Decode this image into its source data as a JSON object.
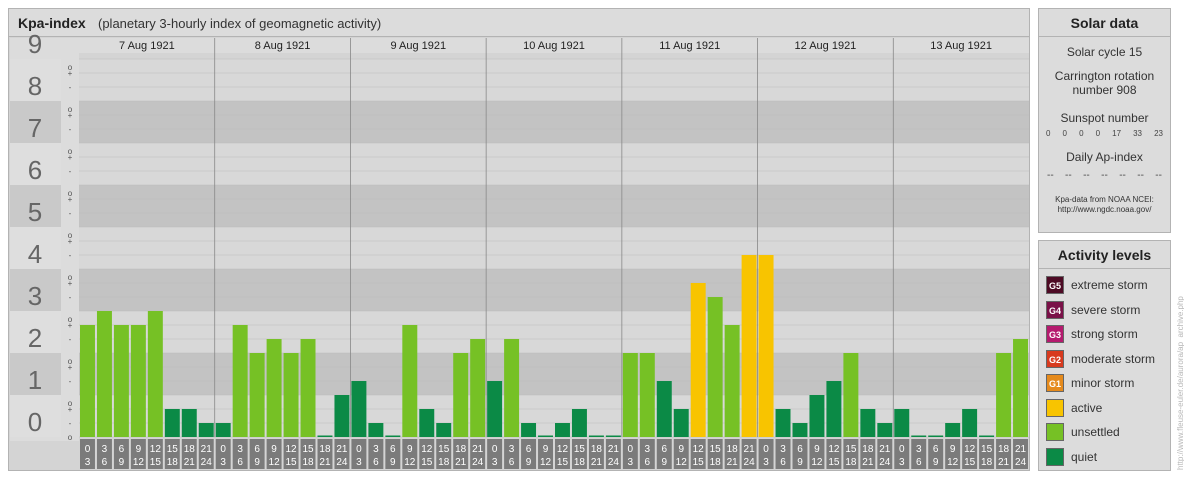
{
  "chart_data": {
    "type": "bar",
    "title": "Kpa-index",
    "subtitle": "(planetary 3-hourly index of geomagnetic activity)",
    "ylim": [
      0,
      9
    ],
    "y_ticks": [
      "0",
      "1",
      "2",
      "3",
      "4",
      "5",
      "6",
      "7",
      "8",
      "9"
    ],
    "minor_marks": [
      "-",
      "+",
      "o"
    ],
    "days": [
      "7 Aug 1921",
      "8 Aug 1921",
      "9 Aug 1921",
      "10 Aug 1921",
      "11 Aug 1921",
      "12 Aug 1921",
      "13 Aug 1921"
    ],
    "interval_start": [
      "0",
      "3",
      "6",
      "9",
      "12",
      "15",
      "18",
      "21"
    ],
    "interval_end": [
      "3",
      "6",
      "9",
      "12",
      "15",
      "18",
      "21",
      "24"
    ],
    "values": [
      2.667,
      3.0,
      2.667,
      2.667,
      3.0,
      0.667,
      0.667,
      0.333,
      0.333,
      2.667,
      2.0,
      2.333,
      2.0,
      2.333,
      0.0,
      1.0,
      1.333,
      0.333,
      0.0,
      2.667,
      0.667,
      0.333,
      2.0,
      2.333,
      1.333,
      2.333,
      0.333,
      0.0,
      0.333,
      0.667,
      0.0,
      0.0,
      2.0,
      2.0,
      1.333,
      0.667,
      3.667,
      3.333,
      2.667,
      4.333,
      4.333,
      0.667,
      0.333,
      1.0,
      1.333,
      2.0,
      0.667,
      0.333,
      0.667,
      0.0,
      0.0,
      0.333,
      0.667,
      0.0,
      2.0,
      2.333
    ],
    "grid": true
  },
  "colors": {
    "quiet": "#0b8a46",
    "unsettled": "#76c125",
    "active": "#f8c400",
    "band_dark": "#c3c3c3",
    "band_light": "#d8d8d8",
    "axis_bg": "#dcdcdc",
    "label_bg": "#7b7b7b"
  },
  "solar": {
    "title": "Solar data",
    "cycle": "Solar cycle 15",
    "carrington_line1": "Carrington rotation",
    "carrington_line2": "number 908",
    "sunspot_label": "Sunspot number",
    "sunspot_values": [
      "0",
      "0",
      "0",
      "0",
      "17",
      "33",
      "23"
    ],
    "ap_label": "Daily Ap-index",
    "ap_values": [
      "--",
      "--",
      "--",
      "--",
      "--",
      "--",
      "--"
    ],
    "credit_line1": "Kpa-data from NOAA NCEI:",
    "credit_line2": "http://www.ngdc.noaa.gov/"
  },
  "levels": {
    "title": "Activity levels",
    "items": [
      {
        "code": "G5",
        "label": "extreme storm",
        "color": "#4d0a24"
      },
      {
        "code": "G4",
        "label": "severe storm",
        "color": "#7a1148"
      },
      {
        "code": "G3",
        "label": "strong storm",
        "color": "#b51a6e"
      },
      {
        "code": "G2",
        "label": "moderate storm",
        "color": "#d83a1e"
      },
      {
        "code": "G1",
        "label": "minor storm",
        "color": "#e58a1c"
      },
      {
        "code": "",
        "label": "active",
        "color": "#f8c400"
      },
      {
        "code": "",
        "label": "unsettled",
        "color": "#76c125"
      },
      {
        "code": "",
        "label": "quiet",
        "color": "#0b8a46"
      }
    ]
  },
  "copyright": "http://www.fleuse-euler.de/aurora/ap_archive.php"
}
